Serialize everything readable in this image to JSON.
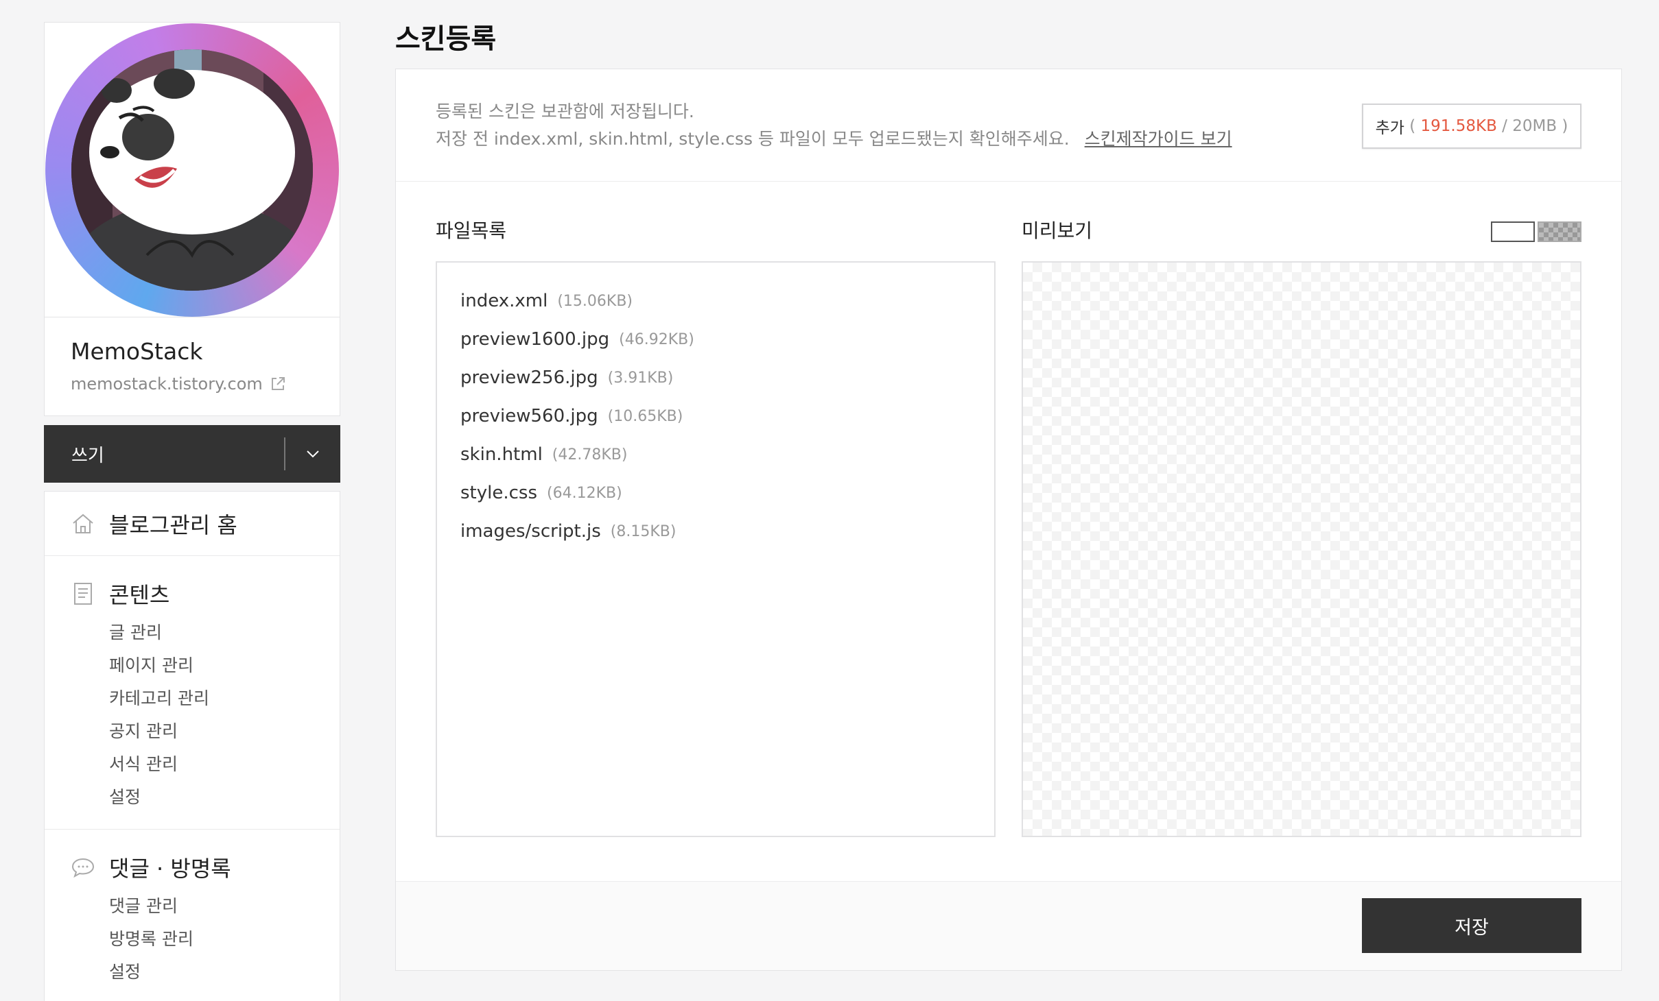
{
  "profile": {
    "blog_name": "MemoStack",
    "blog_url": "memostack.tistory.com"
  },
  "write": {
    "label": "쓰기"
  },
  "menu": {
    "home_label": "블로그관리 홈",
    "contents": {
      "title": "콘텐츠",
      "items": [
        "글 관리",
        "페이지 관리",
        "카테고리 관리",
        "공지 관리",
        "서식 관리",
        "설정"
      ]
    },
    "comments": {
      "title": "댓글 · 방명록",
      "items": [
        "댓글 관리",
        "방명록 관리",
        "설정"
      ]
    }
  },
  "page": {
    "title": "스킨등록"
  },
  "notice": {
    "line1": "등록된 스킨은 보관함에 저장됩니다.",
    "line2": "저장 전 index.xml, skin.html, style.css 등 파일이 모두 업로드됐는지 확인해주세요.",
    "guide_link": "스킨제작가이드 보기"
  },
  "add_button": {
    "label": "추가",
    "open": "(",
    "used": "191.58KB",
    "limit": "/ 20MB )"
  },
  "files": {
    "title": "파일목록",
    "items": [
      {
        "name": "index.xml",
        "size": "(15.06KB)"
      },
      {
        "name": "preview1600.jpg",
        "size": "(46.92KB)"
      },
      {
        "name": "preview256.jpg",
        "size": "(3.91KB)"
      },
      {
        "name": "preview560.jpg",
        "size": "(10.65KB)"
      },
      {
        "name": "skin.html",
        "size": "(42.78KB)"
      },
      {
        "name": "style.css",
        "size": "(64.12KB)"
      },
      {
        "name": "images/script.js",
        "size": "(8.15KB)"
      }
    ]
  },
  "preview": {
    "title": "미리보기"
  },
  "save": {
    "label": "저장"
  },
  "colors": {
    "accent_used": "#e4583f",
    "dark_button": "#333333"
  }
}
